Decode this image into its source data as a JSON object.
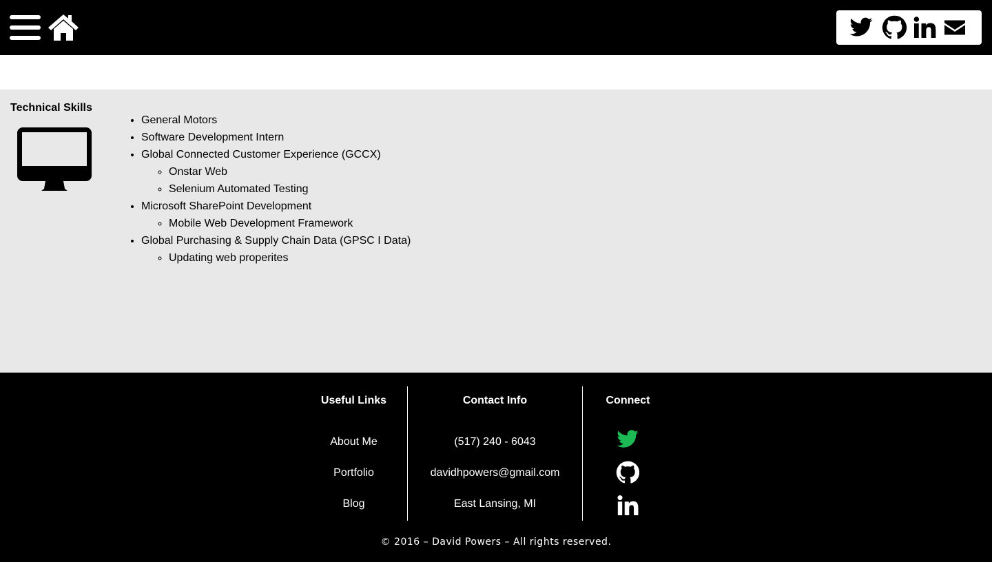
{
  "header": {
    "icons": {
      "menu": "hamburger-menu-icon",
      "home": "home-icon"
    },
    "social": [
      "twitter-icon",
      "github-icon",
      "linkedin-icon",
      "envelope-icon"
    ]
  },
  "skills": {
    "heading": "Technical Skills",
    "icon": "desktop-monitor-icon",
    "items": [
      "General Motors",
      "Software Development Intern",
      "Global Connected Customer Experience (GCCX)",
      "Onstar Web",
      "Selenium Automated Testing",
      "Microsoft SharePoint Development",
      "Mobile Web Development Framework",
      "Global Purchasing & Supply Chain Data (GPSC I Data)",
      "Updating web properites"
    ]
  },
  "footer": {
    "useful_links": {
      "heading": "Useful Links",
      "items": [
        "About Me",
        "Portfolio",
        "Blog"
      ]
    },
    "contact": {
      "heading": "Contact Info",
      "phone": "(517) 240 - 6043",
      "email": "davidhpowers@gmail.com",
      "location": "East Lansing, MI"
    },
    "connect": {
      "heading": "Connect",
      "icons": [
        "twitter-icon",
        "github-icon",
        "linkedin-icon"
      ]
    },
    "copyright": "©   2016 – David Powers – All rights reserved."
  },
  "colors": {
    "background": "#000000",
    "panel": "#e8e8e8",
    "twitter_green": "#1db954"
  }
}
